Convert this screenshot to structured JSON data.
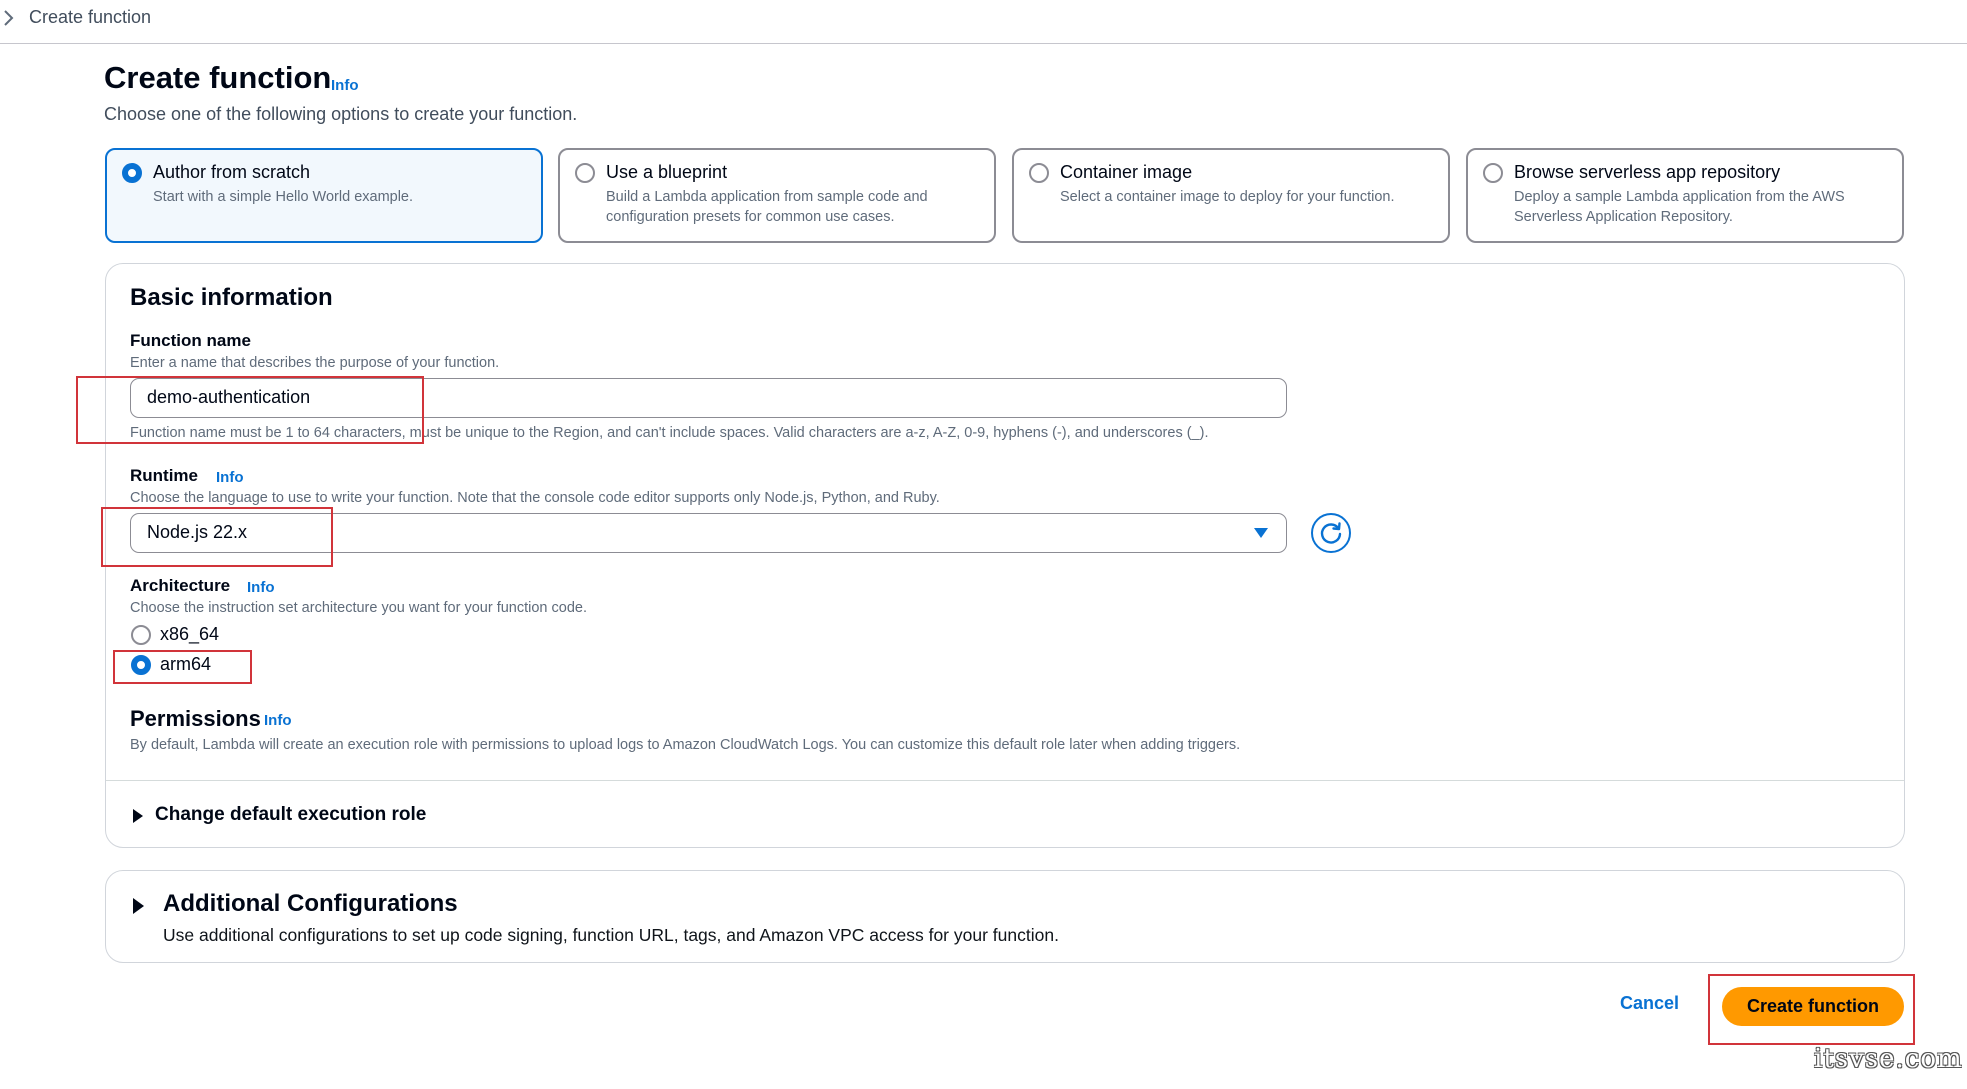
{
  "breadcrumb": {
    "current": "Create function"
  },
  "header": {
    "title": "Create function",
    "info_label": "Info",
    "subtitle": "Choose one of the following options to create your function."
  },
  "options": [
    {
      "title": "Author from scratch",
      "description": "Start with a simple Hello World example.",
      "selected": true
    },
    {
      "title": "Use a blueprint",
      "description": "Build a Lambda application from sample code and configuration presets for common use cases.",
      "selected": false
    },
    {
      "title": "Container image",
      "description": "Select a container image to deploy for your function.",
      "selected": false
    },
    {
      "title": "Browse serverless app repository",
      "description": "Deploy a sample Lambda application from the AWS Serverless Application Repository.",
      "selected": false
    }
  ],
  "basic_info": {
    "title": "Basic information",
    "function_name": {
      "label": "Function name",
      "description": "Enter a name that describes the purpose of your function.",
      "value": "demo-authentication",
      "constraint": "Function name must be 1 to 64 characters, must be unique to the Region, and can't include spaces. Valid characters are a-z, A-Z, 0-9, hyphens (-), and underscores (_)."
    },
    "runtime": {
      "label": "Runtime",
      "info_label": "Info",
      "description": "Choose the language to use to write your function. Note that the console code editor supports only Node.js, Python, and Ruby.",
      "value": "Node.js 22.x"
    },
    "architecture": {
      "label": "Architecture",
      "info_label": "Info",
      "description": "Choose the instruction set architecture you want for your function code.",
      "options": [
        {
          "label": "x86_64",
          "selected": false
        },
        {
          "label": "arm64",
          "selected": true
        }
      ]
    },
    "permissions": {
      "label": "Permissions",
      "info_label": "Info",
      "description": "By default, Lambda will create an execution role with permissions to upload logs to Amazon CloudWatch Logs. You can customize this default role later when adding triggers."
    },
    "execution_role_expander": "Change default execution role"
  },
  "additional": {
    "title": "Additional Configurations",
    "description": "Use additional configurations to set up code signing, function URL, tags, and Amazon VPC access for your function."
  },
  "footer": {
    "cancel_label": "Cancel",
    "create_label": "Create function"
  },
  "watermark": "itsvse.com",
  "colors": {
    "accent": "#0972d3",
    "primary_button": "#ff9900",
    "annotation": "#d1343a"
  }
}
